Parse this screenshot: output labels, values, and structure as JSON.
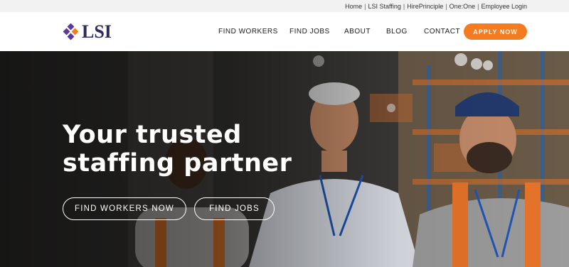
{
  "utility_nav": {
    "links": [
      "Home",
      "LSI Staffing",
      "HirePrinciple",
      "One:One",
      "Employee Login"
    ],
    "separator": "|"
  },
  "header": {
    "logo_text": "LSI",
    "nav": {
      "find_workers": "FIND WORKERS",
      "find_jobs": "FIND JOBS",
      "about": "ABOUT",
      "blog": "BLOG",
      "contact": "CONTACT"
    },
    "apply_label": "APPLY NOW"
  },
  "hero": {
    "title_line1": "Your trusted",
    "title_line2": "staffing partner",
    "primary_cta": "FIND WORKERS NOW",
    "secondary_cta": "FIND JOBS"
  },
  "colors": {
    "accent": "#f47b20",
    "brand_navy": "#2b2b5e",
    "logo_purple": "#5b3a9e",
    "logo_orange": "#f47b20"
  }
}
